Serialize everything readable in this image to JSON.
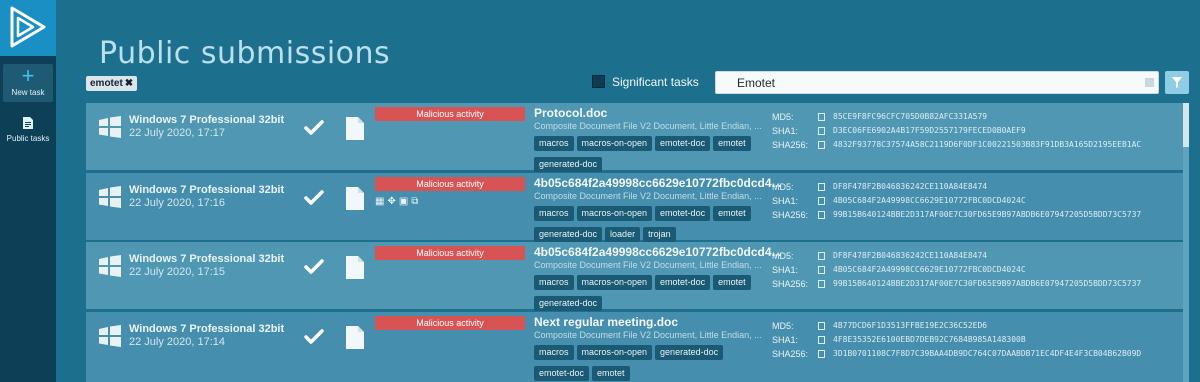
{
  "sidebar": {
    "items": [
      {
        "label": "New task",
        "icon": "plus-icon"
      },
      {
        "label": "Public tasks",
        "icon": "document-icon"
      }
    ]
  },
  "header": {
    "title": "Public submissions",
    "filter_chip": "emotet",
    "significant_label": "Significant tasks",
    "search_value": "Emotet"
  },
  "colors": {
    "background": "#1d6f8e",
    "sidebar": "#0d3f56",
    "accent": "#1a8fc4",
    "verdict_malicious": "#d85454",
    "tag_bg": "#1b5a74"
  },
  "rows": [
    {
      "os": "Windows 7 Professional 32bit",
      "date": "22 July 2020, 17:17",
      "verdict": "Malicious activity",
      "filename": "Protocol.doc",
      "filetype": "Composite Document File V2 Document, Little Endian, ...",
      "tags": [
        "macros",
        "macros-on-open",
        "emotet-doc",
        "emotet",
        "generated-doc"
      ],
      "md5": "85CE9F8FC96CFC705D0B82AFC331A579",
      "sha1": "D3EC06FE6902A4B17F59D2557179FECED0B0AEF9",
      "sha256": "4832F93778C37574A58C2119D6F0DF1C00221503B83F91DB3A165D2195EEB1AC"
    },
    {
      "os": "Windows 7 Professional 32bit",
      "date": "22 July 2020, 17:16",
      "verdict": "Malicious activity",
      "filename": "4b05c684f2a49998cc6629e10772fbc0dcd4...",
      "filetype": "Composite Document File V2 Document, Little Endian, ...",
      "tags": [
        "macros",
        "macros-on-open",
        "emotet-doc",
        "emotet",
        "generated-doc",
        "loader",
        "trojan"
      ],
      "md5": "DF8F478F2B046836242CE110A84E8474",
      "sha1": "4B05C684F2A49998CC6629E10772FBC0DCD4024C",
      "sha256": "99B15B640124BBE2D317AF00E7C30FD65E9B97ABDB6E07947205D5BDD73C5737"
    },
    {
      "os": "Windows 7 Professional 32bit",
      "date": "22 July 2020, 17:15",
      "verdict": "Malicious activity",
      "filename": "4b05c684f2a49998cc6629e10772fbc0dcd4...",
      "filetype": "Composite Document File V2 Document, Little Endian, ...",
      "tags": [
        "macros",
        "macros-on-open",
        "emotet-doc",
        "emotet",
        "generated-doc"
      ],
      "md5": "DF8F478F2B046836242CE110A84E8474",
      "sha1": "4B05C684F2A49998CC6629E10772FBC0DCD4024C",
      "sha256": "99B15B640124BBE2D317AF00E7C30FD65E9B97ABDB6E07947205D5BDD73C5737"
    },
    {
      "os": "Windows 7 Professional 32bit",
      "date": "22 July 2020, 17:14",
      "verdict": "Malicious activity",
      "filename": "Next regular meeting.doc",
      "filetype": "Composite Document File V2 Document, Little Endian, ...",
      "tags": [
        "macros",
        "macros-on-open",
        "generated-doc",
        "emotet-doc",
        "emotet"
      ],
      "md5": "4B77DCD6F1D3513FFBE19E2C36C52ED6",
      "sha1": "4F8E35352E6100EBD7DEB92C7684B985A148300B",
      "sha256": "3D1B0701108C7F8D7C39BAA4DB9DC764C07DAABDB71EC4DF4E4F3CB04B62B09D"
    }
  ],
  "hash_labels": {
    "md5": "MD5:",
    "sha1": "SHA1:",
    "sha256": "SHA256:"
  }
}
